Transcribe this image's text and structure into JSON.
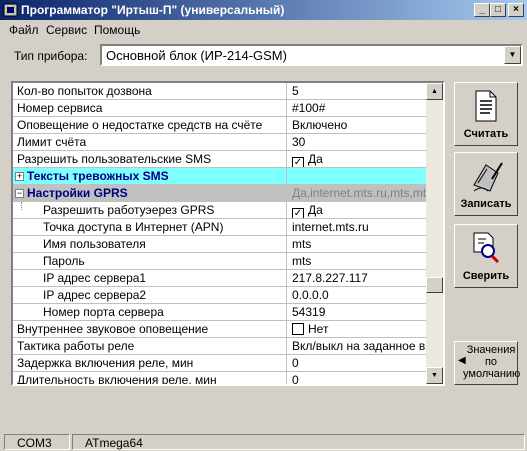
{
  "window": {
    "title": "Программатор \"Иртыш-П\" (универсальный)",
    "app_icon": "app-logo-icon",
    "controls": [
      "minimize",
      "maximize",
      "close"
    ]
  },
  "menu": [
    "Файл",
    "Сервис",
    "Помощь"
  ],
  "device": {
    "label": "Тип прибора:",
    "selected": "Основной блок (ИР-214-GSM)"
  },
  "grid": {
    "rows": [
      {
        "name": "Кол-во попыток дозвона",
        "value": "5"
      },
      {
        "name": "Номер сервиса",
        "value": "#100#"
      },
      {
        "name": "Оповещение о недостатке средств на счёте",
        "value": "Включено"
      },
      {
        "name": "Лимит счёта",
        "value": "30"
      },
      {
        "name": "Разрешить пользовательские SMS",
        "value": "Да",
        "checked": true
      },
      {
        "name": "Тексты тревожных SMS",
        "value": "",
        "category": "collapsed"
      },
      {
        "name": "Настройки GPRS",
        "value": "Да,internet.mts.ru,mts,mts",
        "category": "expanded"
      },
      {
        "name": "Разрешить работуэерез GPRS",
        "value": "Да",
        "checked": true,
        "child": true
      },
      {
        "name": "Точка доступа в Интернет (APN)",
        "value": "internet.mts.ru",
        "child": true
      },
      {
        "name": "Имя пользователя",
        "value": "mts",
        "child": true
      },
      {
        "name": "Пароль",
        "value": "mts",
        "child": true
      },
      {
        "name": "IP адрес сервера1",
        "value": "217.8.227.117",
        "child": true
      },
      {
        "name": "IP адрес сервера2",
        "value": "0.0.0.0",
        "child": true
      },
      {
        "name": "Номер порта сервера",
        "value": "54319",
        "child": true
      },
      {
        "name": "Внутреннее звуковое оповещение",
        "value": "Нет",
        "checked": false
      },
      {
        "name": "Тактика работы реле",
        "value": "Вкл/выкл на заданное вр"
      },
      {
        "name": "Задержка включения реле, мин",
        "value": "0"
      },
      {
        "name": "Длительность включения реле, мин",
        "value": "0"
      }
    ]
  },
  "buttons": {
    "read": "Считать",
    "write": "Записать",
    "verify": "Сверить",
    "defaults_line1": "Значения",
    "defaults_line2": "по",
    "defaults_line3": "умолчанию"
  },
  "status": {
    "port": "COM3",
    "chip": "ATmega64"
  },
  "colors": {
    "titlebar_start": "#0a246a",
    "titlebar_end": "#a6caf0",
    "category_bg": "#80ffff",
    "category_text": "#00007f"
  }
}
